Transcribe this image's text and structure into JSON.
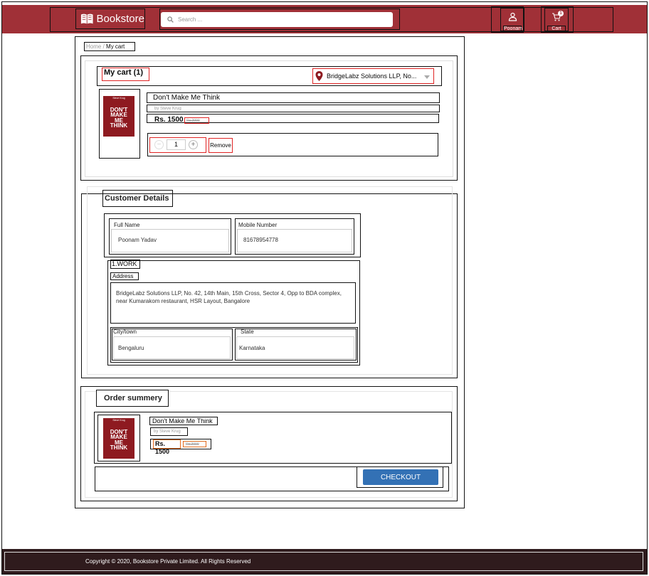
{
  "header": {
    "brand": "Bookstore",
    "search_placeholder": "Search ...",
    "profile_label": "Poonam",
    "cart_label": "Cart",
    "cart_count": "1",
    "colors": {
      "header_bg": "#a03037",
      "footer_bg": "#2f1b1d",
      "accent": "#3371b5"
    }
  },
  "breadcrumb": {
    "home": "Home",
    "separator": "/",
    "current": "My cart"
  },
  "cart": {
    "title": "My cart (1)",
    "location": "BridgeLabz Solutions LLP, No...",
    "item": {
      "name": "Don't Make Me Think",
      "author": "by Steve Krug",
      "price": "Rs. 1500",
      "old_price": "Rs.2000",
      "quantity": "1",
      "remove_label": "Remove",
      "cover_author": "Steve Krug",
      "cover_title": "DON'T MAKE ME THINK"
    }
  },
  "customer": {
    "title": "Customer Details",
    "full_name_label": "Full Name",
    "full_name": "Poonam Yadav",
    "mobile_label": "Mobile Number",
    "mobile": "81678954778",
    "address_type": "1.WORK",
    "address_label": "Address",
    "address": "BridgeLabz Solutions LLP, No. 42, 14th Main, 15th Cross, Sector 4, Opp to BDA complex, near Kumarakom restaurant, HSR Layout, Bangalore",
    "city_label": "City/town",
    "city": "Bengaluru",
    "state_label": "State",
    "state": "Karnataka"
  },
  "order": {
    "title": "Order summery",
    "name": "Don't Make Me Think",
    "author": "by Steve Krug",
    "price": "Rs. 1500",
    "old_price": "Rs.2000",
    "checkout_label": "CHECKOUT"
  },
  "footer": {
    "copyright": "Copyright © 2020, Bookstore Private Limited. All Rights Reserved"
  }
}
